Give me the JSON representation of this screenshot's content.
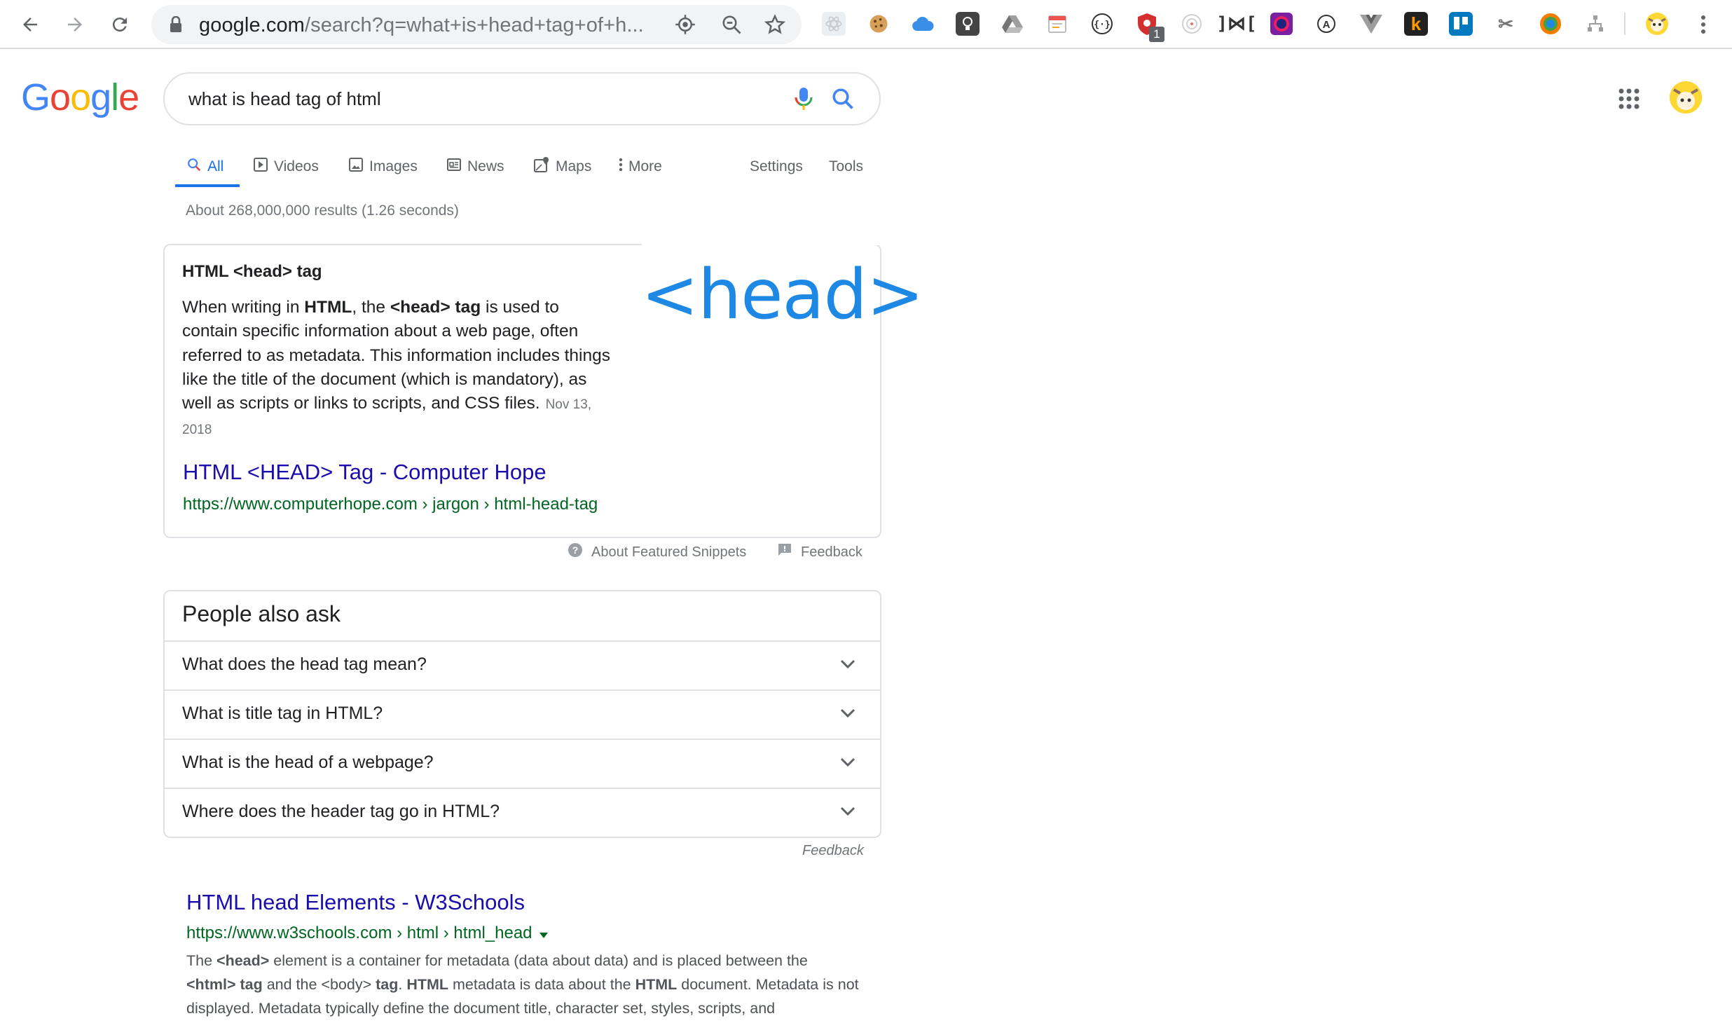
{
  "browser": {
    "url_host": "google.com",
    "url_path": "/search?q=what+is+head+tag+of+h...",
    "extension_badge": "1",
    "icons": [
      "back-icon",
      "forward-icon",
      "reload-icon",
      "lock-icon",
      "location-icon",
      "zoom-icon",
      "bookmark-star-icon",
      "menu-dots-icon"
    ],
    "extensions": [
      "react-devtools-icon",
      "cookie-icon",
      "cloud-icon",
      "lightbulb-icon",
      "drive-icon",
      "calendar-icon",
      "code-icon",
      "ublock-icon",
      "target-icon",
      "bracket-icon",
      "color-picker-icon",
      "a-icon",
      "vue-icon",
      "k-icon",
      "trello-icon",
      "scissors-icon",
      "chrome-color-icon",
      "tree-icon",
      "profile-avatar-icon"
    ]
  },
  "google": {
    "logo": [
      "G",
      "o",
      "o",
      "g",
      "l",
      "e"
    ],
    "logo_colors": [
      "#4285F4",
      "#EA4335",
      "#FBBC05",
      "#4285F4",
      "#34A853",
      "#EA4335"
    ],
    "query": "what is head tag of html"
  },
  "tabs": {
    "all": "All",
    "videos": "Videos",
    "images": "Images",
    "news": "News",
    "maps": "Maps",
    "more": "More",
    "settings": "Settings",
    "tools": "Tools"
  },
  "results_stats": "About 268,000,000 results (1.26 seconds)",
  "featured_snippet": {
    "heading": "HTML <head> tag",
    "text_parts": [
      "When writing in ",
      "HTML",
      ", the ",
      "<head>",
      " ",
      "tag",
      " is used to contain specific information about a web page, often referred to as metadata. This information includes things like the title of the document (which is mandatory), as well as scripts or links to scripts, and CSS files."
    ],
    "date": "Nov 13, 2018",
    "image_text": "<head>",
    "link_title": "HTML <HEAD> Tag - Computer Hope",
    "link_url": "https://www.computerhope.com › jargon › html-head-tag",
    "about_label": "About Featured Snippets",
    "feedback_label": "Feedback"
  },
  "people_also_ask": {
    "title": "People also ask",
    "questions": [
      "What does the head tag mean?",
      "What is title tag in HTML?",
      "What is the head of a webpage?",
      "Where does the header tag go in HTML?"
    ],
    "feedback_label": "Feedback"
  },
  "result_1": {
    "title": "HTML head Elements - W3Schools",
    "url": "https://www.w3schools.com › html › html_head",
    "snippet_parts": [
      "The ",
      "<head>",
      " element is a container for metadata (data about data) and is placed between the ",
      "<html>",
      " ",
      "tag",
      " and the <body> ",
      "tag",
      ". ",
      "HTML",
      " metadata is data about the ",
      "HTML",
      " document. Metadata is not displayed. Metadata typically define the document title, character set, styles, scripts, and"
    ]
  },
  "colors": {
    "link": "#1a0dab",
    "url_green": "#006621",
    "accent_blue": "#1a73e8",
    "snippet_image_blue": "#1e88e5"
  }
}
